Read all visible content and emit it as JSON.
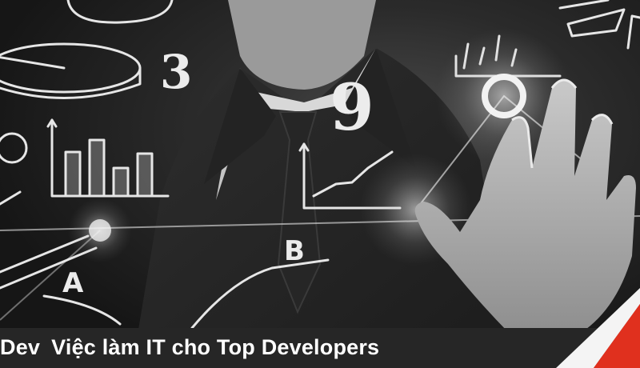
{
  "banner": {
    "caption_brand": "Dev",
    "caption_text": "Việc làm IT cho Top Developers",
    "sketch_labels": {
      "a": "A",
      "b": "B",
      "num3": "3",
      "num9": "9"
    },
    "accent_color": "#e0301e"
  }
}
